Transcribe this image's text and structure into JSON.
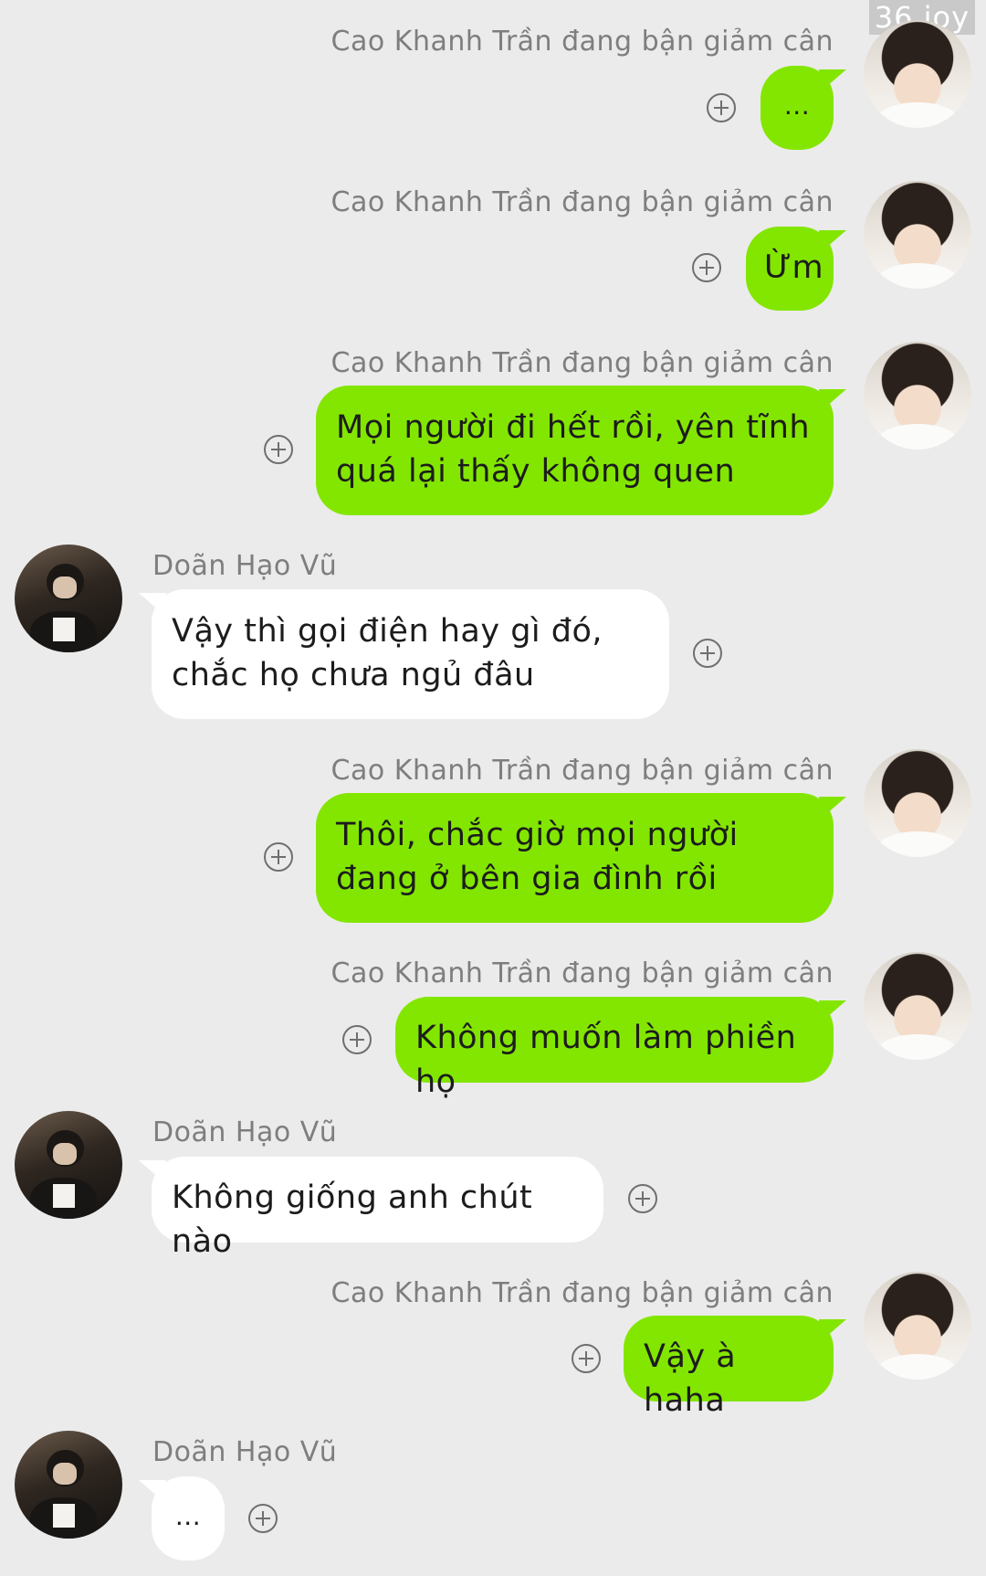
{
  "watermark": "36 joy",
  "messages": [
    {
      "sender": "Cao Khanh Trần đang bận giảm cân",
      "text": "...",
      "side": "self"
    },
    {
      "sender": "Cao Khanh Trần đang bận giảm cân",
      "text": "Ừm",
      "side": "self"
    },
    {
      "sender": "Cao Khanh Trần đang bận giảm cân",
      "text": "Mọi người đi hết rồi, yên tĩnh quá lại thấy không quen",
      "side": "self"
    },
    {
      "sender": "Doãn Hạo Vũ",
      "text": "Vậy thì gọi điện hay gì đó, chắc họ chưa ngủ đâu",
      "side": "other"
    },
    {
      "sender": "Cao Khanh Trần đang bận giảm cân",
      "text": "Thôi, chắc giờ mọi người đang ở bên gia đình rồi",
      "side": "self"
    },
    {
      "sender": "Cao Khanh Trần đang bận giảm cân",
      "text": "Không muốn làm phiền họ",
      "side": "self"
    },
    {
      "sender": "Doãn Hạo Vũ",
      "text": "Không giống anh chút nào",
      "side": "other"
    },
    {
      "sender": "Cao Khanh Trần đang bận giảm cân",
      "text": "Vậy à haha",
      "side": "self"
    },
    {
      "sender": "Doãn Hạo Vũ",
      "text": "...",
      "side": "other"
    }
  ],
  "colors": {
    "self_bubble": "#83e600",
    "other_bubble": "#ffffff",
    "background": "#ebebeb"
  }
}
